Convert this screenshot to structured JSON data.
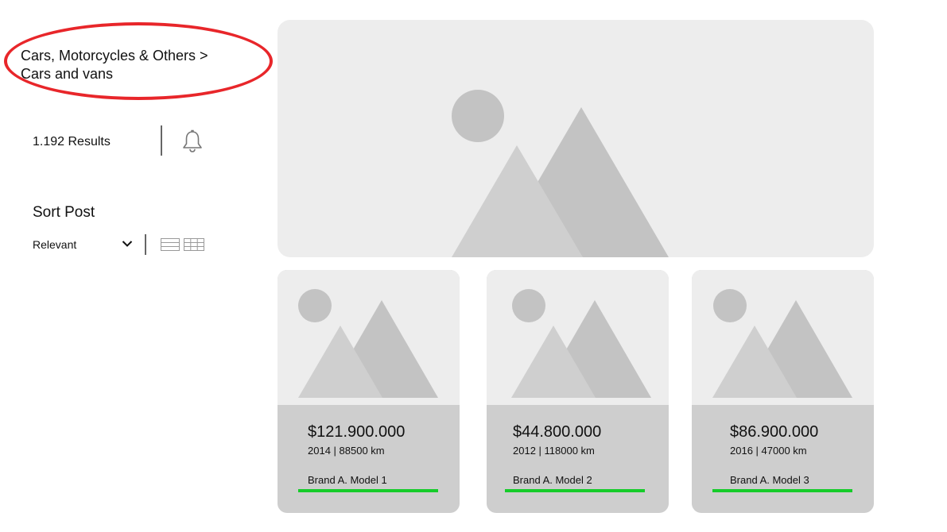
{
  "sidebar": {
    "breadcrumb_line1": "Cars, Motorcycles & Others >",
    "breadcrumb_line2": "Cars and vans",
    "results": "1.192 Results",
    "sort_title": "Sort Post",
    "sort_value": "Relevant"
  },
  "icons": {
    "bell": "bell-icon",
    "chevron": "chevron-down-icon",
    "list_view": "list-view-icon",
    "grid_view": "grid-view-icon",
    "placeholder": "image-placeholder-icon"
  },
  "colors": {
    "annotation": "#e8262a",
    "underline": "#16cc2a",
    "card_footer": "#cecece",
    "placeholder_bg": "#ededed"
  },
  "cards": [
    {
      "price": "$121.900.000",
      "meta": "2014 | 88500 km",
      "model": "Brand A. Model 1"
    },
    {
      "price": "$44.800.000",
      "meta": "2012 | 118000 km",
      "model": "Brand A. Model 2"
    },
    {
      "price": "$86.900.000",
      "meta": "2016 | 47000 km",
      "model": "Brand A. Model 3"
    }
  ]
}
